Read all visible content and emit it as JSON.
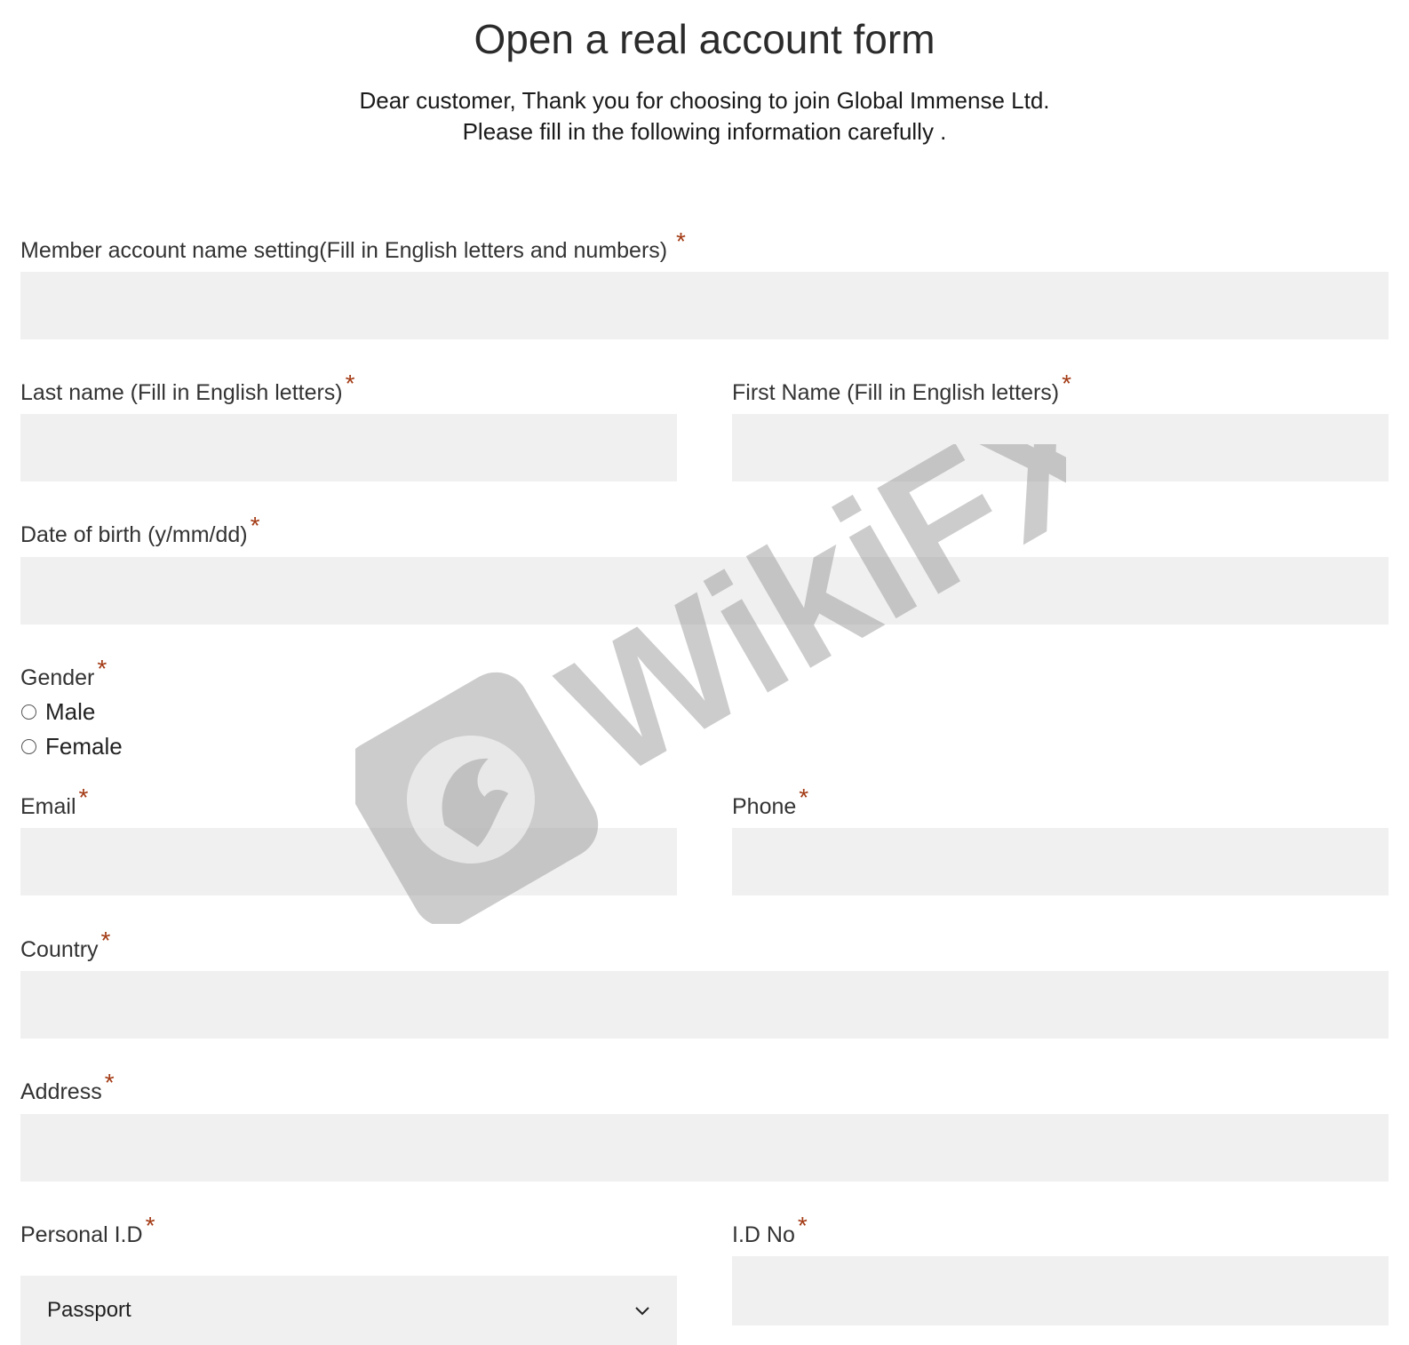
{
  "header": {
    "title": "Open a real account form",
    "intro_line1": "Dear customer, Thank you for choosing to join Global Immense Ltd.",
    "intro_line2": "Please fill in the following information carefully ."
  },
  "form": {
    "required_mark": "*",
    "member_account_label": "Member account name setting(Fill in English letters and numbers) ",
    "last_name_label": "Last name (Fill in English letters)",
    "first_name_label": "First Name (Fill in English letters)",
    "dob_label": "Date of birth (y/mm/dd)",
    "gender_label": "Gender",
    "gender_options": [
      "Male",
      "Female"
    ],
    "email_label": "Email",
    "phone_label": "Phone",
    "country_label": "Country",
    "address_label": "Address",
    "personal_id_label": "Personal I.D",
    "personal_id_selected": "Passport",
    "id_no_label": "I.D No"
  },
  "watermark": {
    "text": "WikiFX",
    "icon": "eagle-logo-icon"
  },
  "colors": {
    "field_bg": "#f0f0f0",
    "required": "#a33a14",
    "text": "#333333"
  }
}
